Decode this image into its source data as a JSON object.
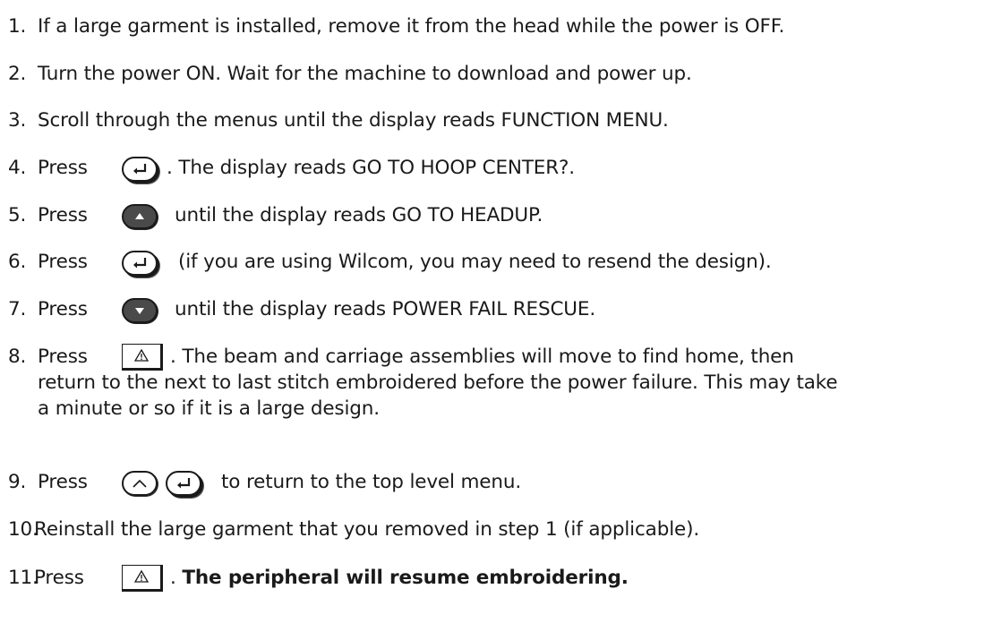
{
  "steps": [
    {
      "number": "1.",
      "text": "If a large garment is installed, remove it from the head while the power is OFF."
    },
    {
      "number": "2.",
      "text": "Turn the power ON. Wait for the machine to download and power up."
    },
    {
      "number": "3.",
      "text": "Scroll through the menus until the display reads FUNCTION MENU."
    },
    {
      "number": "4.",
      "press": "Press",
      "text": ". The display reads GO TO HOOP CENTER?.",
      "icon": "enter-key-icon"
    },
    {
      "number": "5.",
      "press": "Press",
      "text": "until the display reads GO TO HEADUP.",
      "icon": "up-arrow-key-icon"
    },
    {
      "number": "6.",
      "press": "Press",
      "text": "(if you are using Wilcom, you may need to resend the design).",
      "icon": "enter-key-icon"
    },
    {
      "number": "7.",
      "press": "Press",
      "text": "until the display reads POWER FAIL RESCUE.",
      "icon": "down-arrow-key-icon"
    },
    {
      "number": "8.",
      "press": "Press",
      "text": ". The beam and carriage assemblies will move to find home, then",
      "line2": "return to the next to last stitch embroidered before the power failure. This may take",
      "line3": "a minute or so if it is a large design.",
      "icon": "warning-key-icon"
    },
    {
      "number": "9.",
      "press": "Press",
      "text": "to return to the top level menu.",
      "icon": "caret-up-key-icon"
    },
    {
      "number": "10.",
      "text": "Reinstall the large garment that you removed in step 1 (if applicable)."
    },
    {
      "number": "11.",
      "press": "Press",
      "text": ". ",
      "bold_text": "The peripheral will resume embroidering.",
      "icon": "warning-key-icon"
    }
  ]
}
